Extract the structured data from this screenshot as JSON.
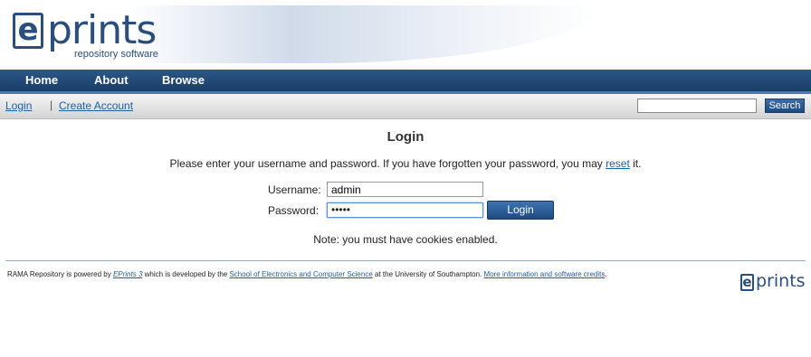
{
  "header": {
    "logo_letter": "e",
    "logo_word": "prints",
    "logo_tagline": "repository software"
  },
  "nav": {
    "items": [
      {
        "label": "Home"
      },
      {
        "label": "About"
      },
      {
        "label": "Browse"
      }
    ]
  },
  "userbar": {
    "login_link": "Login",
    "separator": "|",
    "create_account_link": "Create Account",
    "search_value": "",
    "search_button": "Search"
  },
  "main": {
    "title": "Login",
    "instructions_before": "Please enter your username and password. If you have forgotten your password, you may ",
    "reset_link": "reset",
    "instructions_after": " it.",
    "username_label": "Username:",
    "username_value": "admin",
    "password_label": "Password:",
    "password_masked": "•••••",
    "login_button": "Login",
    "note": "Note: you must have cookies enabled."
  },
  "footer": {
    "text_1": "RAMA Repository is powered by ",
    "eprints_link": "EPrints 3",
    "text_2": " which is developed by the ",
    "school_link": "School of Electronics and Computer Science",
    "text_3": " at the University of Southampton. ",
    "more_info_link": "More information and software credits",
    "text_4": ".",
    "logo_letter": "e",
    "logo_word": "prints"
  },
  "colors": {
    "brand": "#2a4f7c",
    "navbar": "#1a3d66",
    "link": "#1d5fa8"
  }
}
